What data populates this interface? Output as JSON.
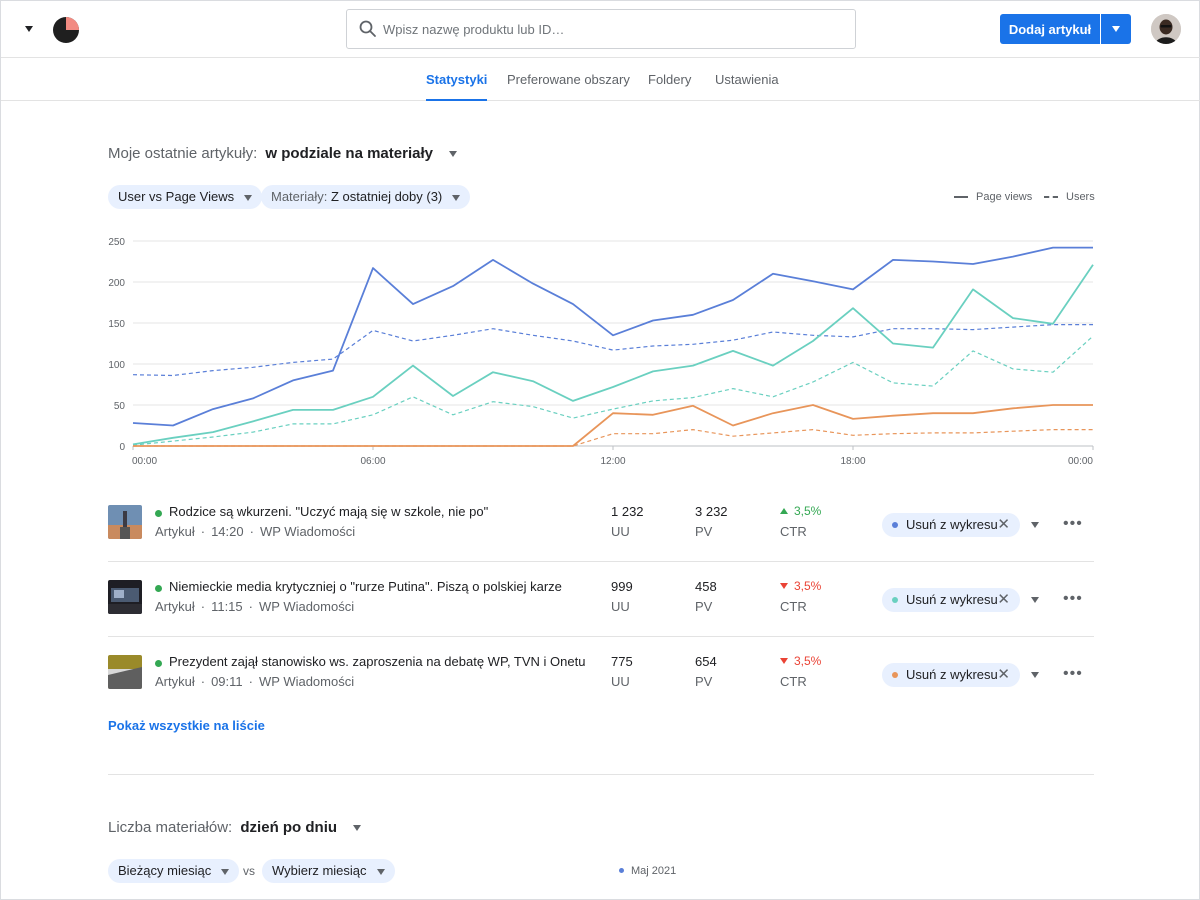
{
  "header": {
    "search_placeholder": "Wpisz nazwę produktu lub ID…",
    "add_button_label": "Dodaj artykuł"
  },
  "tabs": [
    {
      "label": "Statystyki",
      "active": true
    },
    {
      "label": "Preferowane obszary",
      "active": false
    },
    {
      "label": "Foldery",
      "active": false
    },
    {
      "label": "Ustawienia",
      "active": false
    }
  ],
  "section1": {
    "title_prefix": "Moje ostatnie artykuły:",
    "title_value": "w podziale na materiały"
  },
  "filters": {
    "metric_label": "User vs Page Views",
    "materials_prefix": "Materiały:",
    "materials_value": "Z ostatniej doby (3)"
  },
  "legend": {
    "page_views": "Page views",
    "users": "Users"
  },
  "chart_data": {
    "type": "line",
    "x": [
      "00:00",
      "01:00",
      "02:00",
      "03:00",
      "04:00",
      "05:00",
      "06:00",
      "07:00",
      "08:00",
      "09:00",
      "10:00",
      "11:00",
      "12:00",
      "13:00",
      "14:00",
      "15:00",
      "16:00",
      "17:00",
      "18:00",
      "19:00",
      "20:00",
      "21:00",
      "22:00",
      "23:00",
      "00:00"
    ],
    "xticks": [
      "00:00",
      "06:00",
      "12:00",
      "18:00",
      "00:00"
    ],
    "ylim": [
      0,
      250
    ],
    "yticks": [
      0,
      50,
      100,
      150,
      200,
      250
    ],
    "grid": true,
    "series": [
      {
        "name": "Page views",
        "article": 1,
        "style": "solid",
        "color": "#5a7fd8",
        "values": [
          28,
          25,
          45,
          58,
          80,
          92,
          217,
          173,
          195,
          227,
          198,
          173,
          135,
          153,
          160,
          178,
          210,
          201,
          191,
          227,
          225,
          222,
          231,
          242,
          242
        ]
      },
      {
        "name": "Users",
        "article": 1,
        "style": "dashed",
        "color": "#5a7fd8",
        "values": [
          87,
          86,
          92,
          96,
          102,
          106,
          141,
          128,
          135,
          143,
          135,
          128,
          117,
          122,
          124,
          129,
          139,
          135,
          133,
          143,
          143,
          142,
          145,
          148,
          148
        ]
      },
      {
        "name": "Page views",
        "article": 2,
        "style": "solid",
        "color": "#6ad0c0",
        "values": [
          2,
          10,
          17,
          30,
          44,
          44,
          60,
          98,
          61,
          90,
          79,
          55,
          72,
          91,
          98,
          116,
          98,
          128,
          168,
          125,
          120,
          191,
          156,
          149,
          221
        ]
      },
      {
        "name": "Users",
        "article": 2,
        "style": "dashed",
        "color": "#6ad0c0",
        "values": [
          1,
          6,
          11,
          17,
          27,
          27,
          38,
          60,
          38,
          54,
          48,
          34,
          45,
          55,
          59,
          70,
          60,
          78,
          102,
          77,
          73,
          116,
          94,
          90,
          134
        ]
      },
      {
        "name": "Page views",
        "article": 3,
        "style": "solid",
        "color": "#e8955a",
        "values": [
          0,
          0,
          0,
          0,
          0,
          0,
          0,
          0,
          0,
          0,
          0,
          0,
          40,
          38,
          49,
          25,
          40,
          50,
          33,
          37,
          40,
          40,
          46,
          50,
          50
        ]
      },
      {
        "name": "Users",
        "article": 3,
        "style": "dashed",
        "color": "#e8955a",
        "values": [
          0,
          0,
          0,
          0,
          0,
          0,
          0,
          0,
          0,
          0,
          0,
          0,
          15,
          15,
          20,
          12,
          16,
          20,
          13,
          15,
          16,
          16,
          18,
          20,
          20
        ]
      }
    ]
  },
  "articles": [
    {
      "title": "Rodzice są wkurzeni. \"Uczyć mają się w szkole, nie po\"",
      "type": "Artykuł",
      "time": "14:20",
      "source": "WP Wiadomości",
      "uu": "1 232",
      "uu_label": "UU",
      "pv": "3 232",
      "pv_label": "PV",
      "ctr": "3,5%",
      "ctr_label": "CTR",
      "ctr_trend": "up",
      "color": "#5a7fd8",
      "remove_label": "Usuń z wykresu"
    },
    {
      "title": "Niemieckie media krytyczniej o \"rurze Putina\". Piszą o polskiej karze",
      "type": "Artykuł",
      "time": "11:15",
      "source": "WP Wiadomości",
      "uu": "999",
      "uu_label": "UU",
      "pv": "458",
      "pv_label": "PV",
      "ctr": "3,5%",
      "ctr_label": "CTR",
      "ctr_trend": "down",
      "color": "#6ad0c0",
      "remove_label": "Usuń z wykresu"
    },
    {
      "title": "Prezydent zajął stanowisko ws. zaproszenia na debatę WP, TVN i Onetu",
      "type": "Artykuł",
      "time": "09:11",
      "source": "WP Wiadomości",
      "uu": "775",
      "uu_label": "UU",
      "pv": "654",
      "pv_label": "PV",
      "ctr": "3,5%",
      "ctr_label": "CTR",
      "ctr_trend": "down",
      "color": "#e8955a",
      "remove_label": "Usuń z wykresu"
    }
  ],
  "show_all_label": "Pokaż wszystkie na liście",
  "section2": {
    "title_prefix": "Liczba materiałów:",
    "title_value": "dzień po dniu",
    "current_month_label": "Bieżący miesiąc",
    "vs_label": "vs",
    "select_month_label": "Wybierz miesiąc",
    "month_legend": "Maj 2021"
  }
}
